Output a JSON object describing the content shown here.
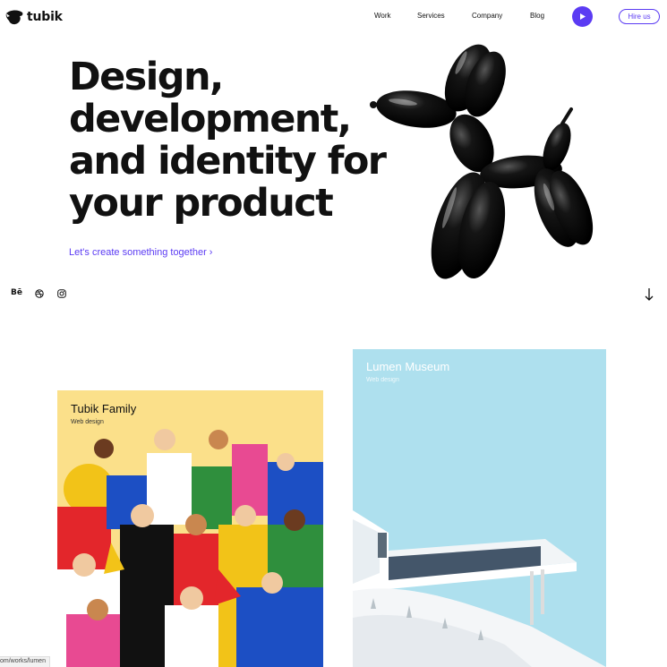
{
  "brand": {
    "name": "tubik"
  },
  "nav": {
    "items": [
      {
        "label": "Work"
      },
      {
        "label": "Services"
      },
      {
        "label": "Company"
      },
      {
        "label": "Blog"
      }
    ],
    "hire_label": "Hire us"
  },
  "hero": {
    "title_lines": [
      "Design,",
      "development,",
      "and identity for",
      "your product"
    ],
    "cta": "Let's create something together ›"
  },
  "social": {
    "behance_label": "Bē",
    "icons": [
      "behance-icon",
      "dribbble-icon",
      "instagram-icon"
    ]
  },
  "scroll_arrow": "↓",
  "cards": [
    {
      "title": "Tubik Family",
      "subtitle": "Web design"
    },
    {
      "title": "Lumen Museum",
      "subtitle": "Web design"
    }
  ],
  "status_bar": {
    "url": "om/works/lumen"
  },
  "colors": {
    "accent": "#5b3bf3",
    "family_bg": "#fbe08a",
    "museum_bg": "#aee0ee"
  }
}
